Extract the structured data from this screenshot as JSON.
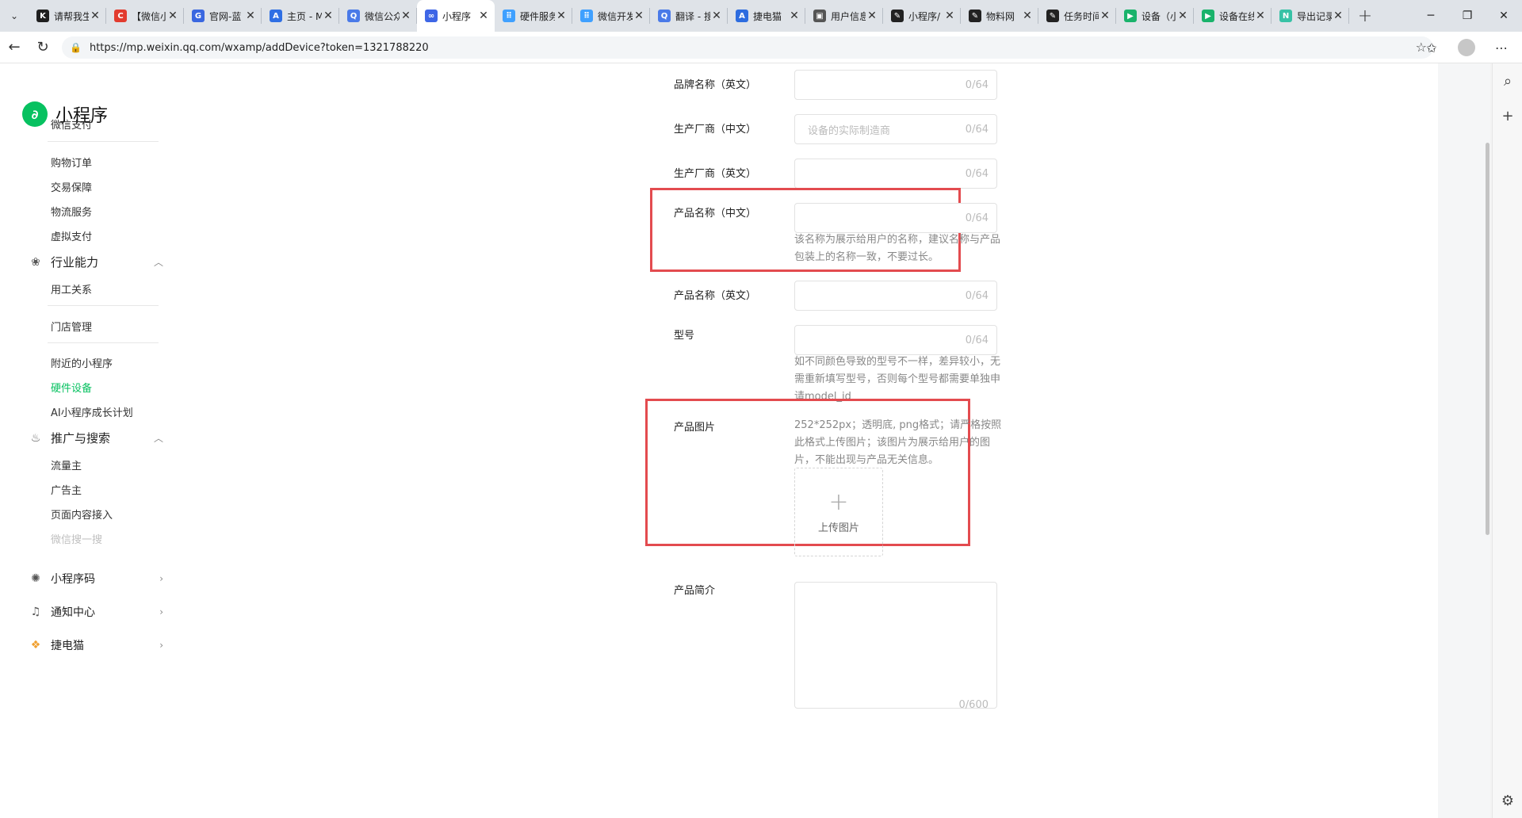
{
  "browser": {
    "tabs": [
      {
        "title": "请帮我生",
        "fav_color": "#1f1f1f",
        "fav_char": "K"
      },
      {
        "title": "【微信小",
        "fav_color": "#e23b2e",
        "fav_char": "C"
      },
      {
        "title": "官网-蓝",
        "fav_color": "#3a67e0",
        "fav_char": "G"
      },
      {
        "title": "主页 - M",
        "fav_color": "#2f6fe4",
        "fav_char": "A"
      },
      {
        "title": "微信公众",
        "fav_color": "#4a7ae8",
        "fav_char": "Q"
      },
      {
        "title": "小程序",
        "fav_color": "#3e66e6",
        "fav_char": "∞",
        "active": true
      },
      {
        "title": "硬件服务",
        "fav_color": "#3fa0ff",
        "fav_char": "⠿"
      },
      {
        "title": "微信开发",
        "fav_color": "#3fa0ff",
        "fav_char": "⠿"
      },
      {
        "title": "翻译 - 搜",
        "fav_color": "#4a7ae8",
        "fav_char": "Q"
      },
      {
        "title": "捷电猫",
        "fav_color": "#2d6cdf",
        "fav_char": "A"
      },
      {
        "title": "用户信息",
        "fav_color": "#555555",
        "fav_char": "▣"
      },
      {
        "title": "小程序/",
        "fav_color": "#222222",
        "fav_char": "✎"
      },
      {
        "title": "物料网",
        "fav_color": "#222222",
        "fav_char": "✎"
      },
      {
        "title": "任务时间",
        "fav_color": "#222222",
        "fav_char": "✎"
      },
      {
        "title": "设备（小",
        "fav_color": "#19b36b",
        "fav_char": "▶"
      },
      {
        "title": "设备在线",
        "fav_color": "#19b36b",
        "fav_char": "▶"
      },
      {
        "title": "导出记录",
        "fav_color": "#37c2a6",
        "fav_char": "N"
      }
    ],
    "url": "https://mp.weixin.qq.com/wxamp/addDevice?token=1321788220"
  },
  "sidebar": {
    "logo_text": "小程序",
    "items_top": [
      {
        "label": "微信支付"
      },
      {
        "label": "购物订单"
      },
      {
        "label": "交易保障"
      },
      {
        "label": "物流服务"
      },
      {
        "label": "虚拟支付"
      }
    ],
    "group_industry": "行业能力",
    "items_industry": [
      {
        "label": "用工关系"
      },
      {
        "label": "门店管理"
      },
      {
        "label": "附近的小程序"
      },
      {
        "label": "硬件设备"
      },
      {
        "label": "AI小程序成长计划"
      }
    ],
    "group_promo": "推广与搜索",
    "items_promo": [
      {
        "label": "流量主"
      },
      {
        "label": "广告主"
      },
      {
        "label": "页面内容接入"
      },
      {
        "label": "微信搜一搜"
      }
    ],
    "group_qrcode": "小程序码",
    "group_notify": "通知中心",
    "group_jdm": "捷电猫"
  },
  "form": {
    "brand_en_label": "品牌名称（英文）",
    "brand_en_count": "0/64",
    "maker_cn_label": "生产厂商（中文）",
    "maker_cn_placeholder": "设备的实际制造商",
    "maker_cn_count": "0/64",
    "maker_en_label": "生产厂商（英文）",
    "maker_en_count": "0/64",
    "product_cn_label": "产品名称（中文）",
    "product_cn_count": "0/64",
    "product_cn_hint": "该名称为展示给用户的名称，建议名称与产品包装上的名称一致，不要过长。",
    "product_en_label": "产品名称（英文）",
    "product_en_count": "0/64",
    "model_label": "型号",
    "model_count": "0/64",
    "model_hint": "如不同颜色导致的型号不一样，差异较小，无需重新填写型号，否则每个型号都需要单独申请model_id",
    "image_label": "产品图片",
    "image_hint": "252*252px；透明底, png格式；请严格按照此格式上传图片；该图片为展示给用户的图片，不能出现与产品无关信息。",
    "upload_label": "上传图片",
    "intro_label": "产品简介",
    "intro_count": "0/600"
  },
  "colors": {
    "accent": "#07c160",
    "highlight": "#e34b4f"
  }
}
